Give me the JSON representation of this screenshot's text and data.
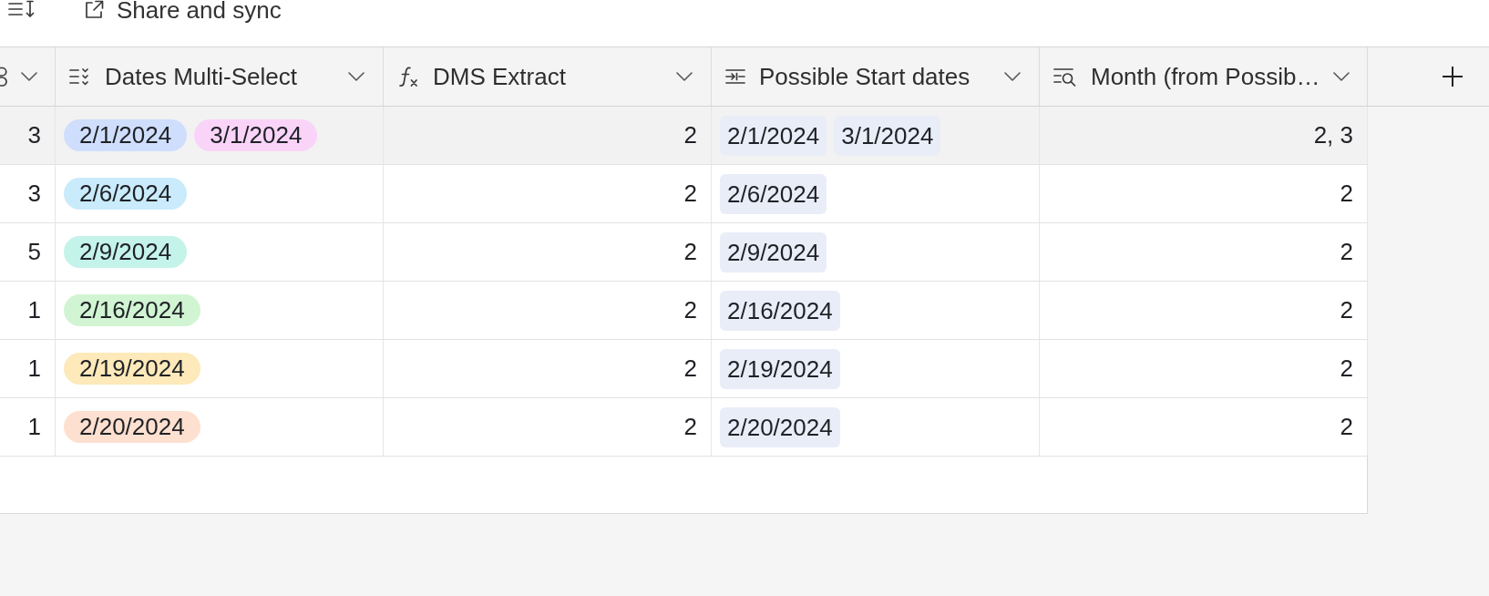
{
  "toolbar": {
    "share_button": {
      "label": "Share and sync"
    }
  },
  "table": {
    "columns": [
      {
        "kind": "cut_off"
      },
      {
        "kind": "multi_select",
        "label": "Dates Multi-Select"
      },
      {
        "kind": "formula",
        "label": "DMS Extract"
      },
      {
        "kind": "link",
        "label": "Possible Start dates"
      },
      {
        "kind": "lookup",
        "label": "Month (from Possib…"
      }
    ],
    "rows": [
      {
        "highlighted": true,
        "cells": [
          {
            "text": "3"
          },
          {
            "options": [
              {
                "label": "2/1/2024",
                "color": "#cfdefc"
              },
              {
                "label": "3/1/2024",
                "color": "#f9d4f8"
              }
            ]
          },
          {
            "text": "2"
          },
          {
            "records": [
              "2/1/2024",
              "3/1/2024"
            ]
          },
          {
            "text": "2, 3"
          }
        ]
      },
      {
        "highlighted": false,
        "cells": [
          {
            "text": "3"
          },
          {
            "options": [
              {
                "label": "2/6/2024",
                "color": "#c9ebfb"
              }
            ]
          },
          {
            "text": "2"
          },
          {
            "records": [
              "2/6/2024"
            ]
          },
          {
            "text": "2"
          }
        ]
      },
      {
        "highlighted": false,
        "cells": [
          {
            "text": "5"
          },
          {
            "options": [
              {
                "label": "2/9/2024",
                "color": "#c4f3ea"
              }
            ]
          },
          {
            "text": "2"
          },
          {
            "records": [
              "2/9/2024"
            ]
          },
          {
            "text": "2"
          }
        ]
      },
      {
        "highlighted": false,
        "cells": [
          {
            "text": "1"
          },
          {
            "options": [
              {
                "label": "2/16/2024",
                "color": "#d1f4d3"
              }
            ]
          },
          {
            "text": "2"
          },
          {
            "records": [
              "2/16/2024"
            ]
          },
          {
            "text": "2"
          }
        ]
      },
      {
        "highlighted": false,
        "cells": [
          {
            "text": "1"
          },
          {
            "options": [
              {
                "label": "2/19/2024",
                "color": "#fde9b9"
              }
            ]
          },
          {
            "text": "2"
          },
          {
            "records": [
              "2/19/2024"
            ]
          },
          {
            "text": "2"
          }
        ]
      },
      {
        "highlighted": false,
        "cells": [
          {
            "text": "1"
          },
          {
            "options": [
              {
                "label": "2/20/2024",
                "color": "#fde0cf"
              }
            ]
          },
          {
            "text": "2"
          },
          {
            "records": [
              "2/20/2024"
            ]
          },
          {
            "text": "2"
          }
        ]
      }
    ]
  }
}
